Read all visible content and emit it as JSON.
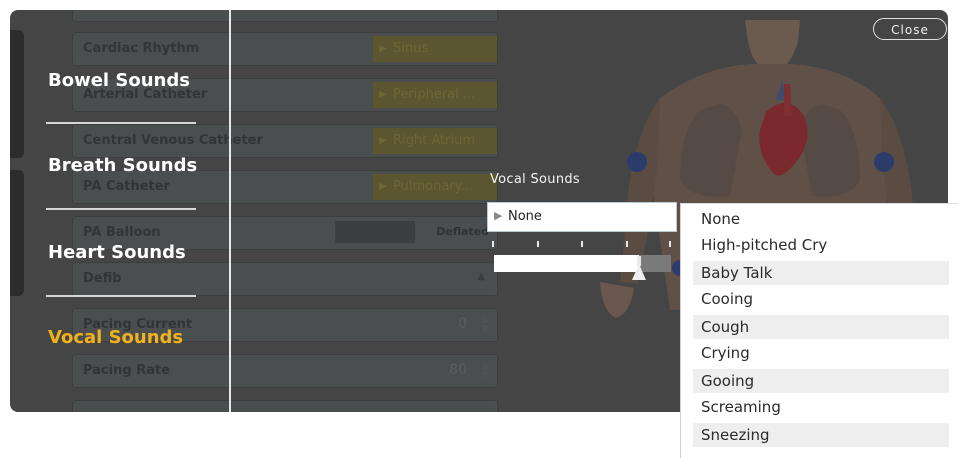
{
  "close_label": "Close",
  "categories": [
    {
      "label": "Bowel Sounds",
      "active": false
    },
    {
      "label": "Breath Sounds",
      "active": false
    },
    {
      "label": "Heart Sounds",
      "active": false
    },
    {
      "label": "Vocal Sounds",
      "active": true
    }
  ],
  "accent_color": "#f2b21c",
  "background_form": {
    "rows": [
      {
        "label": "Cardiac Rhythm",
        "value": "Sinus"
      },
      {
        "label": "Arterial Catheter",
        "value": "Peripheral ..."
      },
      {
        "label": "Central Venous Catheter",
        "value": "Right Atrium"
      },
      {
        "label": "PA Catheter",
        "value": "Pulmonary..."
      },
      {
        "label": "PA Balloon",
        "value": "Deflated"
      },
      {
        "label": "Defib",
        "value": ""
      },
      {
        "label": "Pacing Current",
        "value": "0"
      },
      {
        "label": "Pacing Rate",
        "value": "80"
      }
    ]
  },
  "vocal": {
    "label": "Vocal Sounds",
    "selected": "None",
    "volume_fraction": 0.82,
    "options": [
      "None",
      "High-pitched Cry",
      "Baby Talk",
      "Cooing",
      "Cough",
      "Crying",
      "Gooing",
      "Screaming",
      "Sneezing"
    ]
  }
}
